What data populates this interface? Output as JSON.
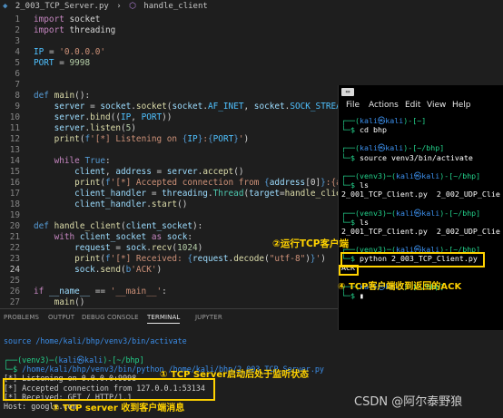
{
  "breadcrumb": {
    "file": "2_003_TCP_Server.py",
    "symbol": "handle_client"
  },
  "editor": {
    "lines": [
      {
        "n": "1",
        "tokens": [
          [
            "kw",
            "import"
          ],
          [
            "",
            ""
          ],
          [
            "",
            " socket"
          ]
        ]
      },
      {
        "n": "2",
        "tokens": [
          [
            "kw",
            "import"
          ],
          [
            "",
            " threading"
          ]
        ]
      },
      {
        "n": "3",
        "tokens": []
      },
      {
        "n": "4",
        "tokens": [
          [
            "cst",
            "IP"
          ],
          [
            "",
            " = "
          ],
          [
            "str",
            "'0.0.0.0'"
          ]
        ]
      },
      {
        "n": "5",
        "tokens": [
          [
            "cst",
            "PORT"
          ],
          [
            "",
            " = "
          ],
          [
            "num",
            "9998"
          ]
        ]
      },
      {
        "n": "6",
        "tokens": []
      },
      {
        "n": "7",
        "tokens": []
      },
      {
        "n": "8",
        "tokens": [
          [
            "kw2",
            "def"
          ],
          [
            "",
            " "
          ],
          [
            "fn",
            "main"
          ],
          [
            "",
            "():"
          ]
        ]
      },
      {
        "n": "9",
        "tokens": [
          [
            "",
            "    "
          ],
          [
            "var",
            "server"
          ],
          [
            "",
            " = "
          ],
          [
            "var",
            "socket"
          ],
          [
            "",
            "."
          ],
          [
            "fn",
            "socket"
          ],
          [
            "",
            "("
          ],
          [
            "var",
            "socket"
          ],
          [
            "",
            "."
          ],
          [
            "cst",
            "AF_INET"
          ],
          [
            "",
            ", "
          ],
          [
            "var",
            "socket"
          ],
          [
            "",
            "."
          ],
          [
            "cst",
            "SOCK_STREAM"
          ],
          [
            "",
            ")"
          ]
        ]
      },
      {
        "n": "10",
        "tokens": [
          [
            "",
            "    "
          ],
          [
            "var",
            "server"
          ],
          [
            "",
            "."
          ],
          [
            "fn",
            "bind"
          ],
          [
            "",
            "(("
          ],
          [
            "cst",
            "IP"
          ],
          [
            "",
            ", "
          ],
          [
            "cst",
            "PORT"
          ],
          [
            "",
            "))"
          ]
        ]
      },
      {
        "n": "11",
        "tokens": [
          [
            "",
            "    "
          ],
          [
            "var",
            "server"
          ],
          [
            "",
            "."
          ],
          [
            "fn",
            "listen"
          ],
          [
            "",
            "("
          ],
          [
            "num",
            "5"
          ],
          [
            "",
            ")"
          ]
        ]
      },
      {
        "n": "12",
        "tokens": [
          [
            "",
            "    "
          ],
          [
            "fn",
            "print"
          ],
          [
            "",
            "("
          ],
          [
            "kw2",
            "f"
          ],
          [
            "str",
            "'[*] Listening on "
          ],
          [
            "kw2",
            "{"
          ],
          [
            "cst",
            "IP"
          ],
          [
            "kw2",
            "}"
          ],
          [
            "str",
            ":"
          ],
          [
            "kw2",
            "{"
          ],
          [
            "cst",
            "PORT"
          ],
          [
            "kw2",
            "}"
          ],
          [
            "str",
            "'"
          ],
          [
            "",
            ")"
          ]
        ]
      },
      {
        "n": "13",
        "tokens": []
      },
      {
        "n": "14",
        "tokens": [
          [
            "",
            "    "
          ],
          [
            "kw",
            "while"
          ],
          [
            "",
            " "
          ],
          [
            "kw2",
            "True"
          ],
          [
            "",
            ":"
          ]
        ]
      },
      {
        "n": "15",
        "tokens": [
          [
            "",
            "        "
          ],
          [
            "var",
            "client"
          ],
          [
            "",
            ", "
          ],
          [
            "var",
            "address"
          ],
          [
            "",
            " = "
          ],
          [
            "var",
            "server"
          ],
          [
            "",
            "."
          ],
          [
            "fn",
            "accept"
          ],
          [
            "",
            "()"
          ]
        ]
      },
      {
        "n": "16",
        "tokens": [
          [
            "",
            "        "
          ],
          [
            "fn",
            "print"
          ],
          [
            "",
            "("
          ],
          [
            "kw2",
            "f"
          ],
          [
            "str",
            "'[*] Accepted connection from "
          ],
          [
            "kw2",
            "{"
          ],
          [
            "var",
            "address"
          ],
          [
            "",
            "[0]"
          ],
          [
            "kw2",
            "}"
          ],
          [
            "str",
            ":{addre"
          ]
        ]
      },
      {
        "n": "17",
        "tokens": [
          [
            "",
            "        "
          ],
          [
            "var",
            "client_handler"
          ],
          [
            "",
            " = "
          ],
          [
            "var",
            "threading"
          ],
          [
            "",
            "."
          ],
          [
            "cls",
            "Thread"
          ],
          [
            "",
            "("
          ],
          [
            "var",
            "target"
          ],
          [
            "",
            "="
          ],
          [
            "fn",
            "handle_client"
          ],
          [
            "",
            ","
          ]
        ]
      },
      {
        "n": "18",
        "tokens": [
          [
            "",
            "        "
          ],
          [
            "var",
            "client_handler"
          ],
          [
            "",
            "."
          ],
          [
            "fn",
            "start"
          ],
          [
            "",
            "()"
          ]
        ]
      },
      {
        "n": "19",
        "tokens": []
      },
      {
        "n": "20",
        "tokens": [
          [
            "kw2",
            "def"
          ],
          [
            "",
            " "
          ],
          [
            "fn",
            "handle_client"
          ],
          [
            "",
            "("
          ],
          [
            "var",
            "client_socket"
          ],
          [
            "",
            "):"
          ]
        ]
      },
      {
        "n": "21",
        "tokens": [
          [
            "",
            "    "
          ],
          [
            "kw",
            "with"
          ],
          [
            "",
            " "
          ],
          [
            "var",
            "client_socket"
          ],
          [
            "",
            " "
          ],
          [
            "kw",
            "as"
          ],
          [
            "",
            " "
          ],
          [
            "var",
            "sock"
          ],
          [
            "",
            ":"
          ]
        ]
      },
      {
        "n": "22",
        "tokens": [
          [
            "",
            "        "
          ],
          [
            "var",
            "request"
          ],
          [
            "",
            " = "
          ],
          [
            "var",
            "sock"
          ],
          [
            "",
            "."
          ],
          [
            "fn",
            "recv"
          ],
          [
            "",
            "("
          ],
          [
            "num",
            "1024"
          ],
          [
            "",
            ")"
          ]
        ]
      },
      {
        "n": "23",
        "tokens": [
          [
            "",
            "        "
          ],
          [
            "fn",
            "print"
          ],
          [
            "",
            "("
          ],
          [
            "kw2",
            "f"
          ],
          [
            "str",
            "'[*] Received: "
          ],
          [
            "kw2",
            "{"
          ],
          [
            "var",
            "request"
          ],
          [
            "",
            "."
          ],
          [
            "fn",
            "decode"
          ],
          [
            "",
            "("
          ],
          [
            "str",
            "\"utf-8\""
          ],
          [
            "",
            ")"
          ],
          [
            "kw2",
            "}"
          ],
          [
            "str",
            "'"
          ],
          [
            "",
            ")"
          ]
        ]
      },
      {
        "n": "24",
        "tokens": [
          [
            "",
            "        "
          ],
          [
            "var",
            "sock"
          ],
          [
            "",
            "."
          ],
          [
            "fn",
            "send"
          ],
          [
            "",
            "("
          ],
          [
            "kw2",
            "b"
          ],
          [
            "str",
            "'ACK'"
          ],
          [
            "",
            ")"
          ]
        ]
      },
      {
        "n": "25",
        "tokens": []
      },
      {
        "n": "26",
        "tokens": [
          [
            "kw",
            "if"
          ],
          [
            "",
            " "
          ],
          [
            "var",
            "__name__"
          ],
          [
            "",
            " == "
          ],
          [
            "str",
            "'__main__'"
          ],
          [
            "",
            ":"
          ]
        ]
      },
      {
        "n": "27",
        "tokens": [
          [
            "",
            "    "
          ],
          [
            "fn",
            "main"
          ],
          [
            "",
            "()"
          ]
        ]
      }
    ],
    "active_line": "24"
  },
  "panel": {
    "tabs": [
      "PROBLEMS",
      "OUTPUT",
      "DEBUG CONSOLE",
      "TERMINAL",
      "JUPYTER"
    ],
    "active_tab": "TERMINAL",
    "lines": [
      {
        "segs": [
          [
            "k-blue",
            "source /home/kali/bhp/venv3/bin/activate"
          ]
        ]
      },
      {
        "segs": [
          [
            "",
            ""
          ]
        ]
      },
      {
        "segs": [
          [
            "k-green",
            "┌──(venv3)─("
          ],
          [
            "k-blue",
            "kali㉿kali"
          ],
          [
            "k-green",
            ")-[~/bhp]"
          ]
        ]
      },
      {
        "segs": [
          [
            "k-green",
            "└─$ "
          ],
          [
            "k-blue",
            "/home/kali/bhp/venv3/bin/python /home/kali/bhp/2_003_TCP_Server.py"
          ]
        ]
      },
      {
        "segs": [
          [
            "",
            "[*] Listening on 0.0.0.0:9998"
          ]
        ]
      },
      {
        "segs": [
          [
            "",
            "[*] Accepted connection from 127.0.0.1:53134"
          ]
        ]
      },
      {
        "segs": [
          [
            "",
            "[*] Received: GET / HTTP/1.1"
          ]
        ]
      },
      {
        "segs": [
          [
            "",
            "Host: google.com"
          ]
        ]
      }
    ]
  },
  "terminal": {
    "icon_label": "▭",
    "menu": [
      "File",
      "Actions",
      "Edit",
      "View",
      "Help"
    ],
    "lines": [
      {
        "segs": [
          [
            "kg",
            "┌──("
          ],
          [
            "kb",
            "kali㉿kali"
          ],
          [
            "kg",
            ")-[~]"
          ]
        ]
      },
      {
        "segs": [
          [
            "kg",
            "└─$ "
          ],
          [
            "kw_",
            "cd bhp"
          ]
        ]
      },
      {
        "segs": [
          [
            "",
            ""
          ]
        ]
      },
      {
        "segs": [
          [
            "kg",
            "┌──("
          ],
          [
            "kb",
            "kali㉿kali"
          ],
          [
            "kg",
            ")-[~/bhp]"
          ]
        ]
      },
      {
        "segs": [
          [
            "kg",
            "└─$ "
          ],
          [
            "kw_",
            "source venv3/bin/activate"
          ]
        ]
      },
      {
        "segs": [
          [
            "",
            ""
          ]
        ]
      },
      {
        "segs": [
          [
            "kg",
            "┌──(venv3)─("
          ],
          [
            "kb",
            "kali㉿kali"
          ],
          [
            "kg",
            ")-[~/bhp]"
          ]
        ]
      },
      {
        "segs": [
          [
            "kg",
            "└─$ "
          ],
          [
            "kw_",
            "ls"
          ]
        ]
      },
      {
        "segs": [
          [
            "kw_",
            "2_001_TCP_Client.py  2_002_UDP_Clie"
          ]
        ]
      },
      {
        "segs": [
          [
            "",
            ""
          ]
        ]
      },
      {
        "segs": [
          [
            "kg",
            "┌──(venv3)─("
          ],
          [
            "kb",
            "kali㉿kali"
          ],
          [
            "kg",
            ")-[~/bhp]"
          ]
        ]
      },
      {
        "segs": [
          [
            "kg",
            "└─$ "
          ],
          [
            "kw_",
            "ls"
          ]
        ]
      },
      {
        "segs": [
          [
            "kw_",
            "2_001_TCP_Client.py  2_002_UDP_Clie"
          ]
        ]
      },
      {
        "segs": [
          [
            "",
            ""
          ]
        ]
      },
      {
        "segs": [
          [
            "kg",
            "┌──(venv3)─("
          ],
          [
            "kb",
            "kali㉿kali"
          ],
          [
            "kg",
            ")-[~/bhp]"
          ]
        ]
      },
      {
        "segs": [
          [
            "kg",
            "└─$ "
          ],
          [
            "kw_",
            "python 2_003_TCP_Client.py"
          ]
        ]
      },
      {
        "segs": [
          [
            "kw_",
            "ACK"
          ]
        ]
      },
      {
        "segs": [
          [
            "",
            ""
          ]
        ]
      },
      {
        "segs": [
          [
            "kg",
            "┌──("
          ],
          [
            "kb",
            "kali㉿kali"
          ],
          [
            "kg",
            ")-[~/bhp]"
          ]
        ]
      },
      {
        "segs": [
          [
            "kg",
            "└─$ "
          ],
          [
            "kw_",
            "▮"
          ]
        ]
      }
    ]
  },
  "annotations": {
    "run_client": "②运行TCP客户端",
    "ack_received": "④ TCP客户端收到返回的ACK",
    "server_listening": "① TCP Server启动后处于监听状态",
    "server_received": "③ TCP server 收到客户端消息"
  },
  "watermark": "CSDN @阿尔泰野狼",
  "colors": {
    "annotation": "#ffd200",
    "editor_bg": "#1e1e1e",
    "terminal_bg": "#000000"
  }
}
